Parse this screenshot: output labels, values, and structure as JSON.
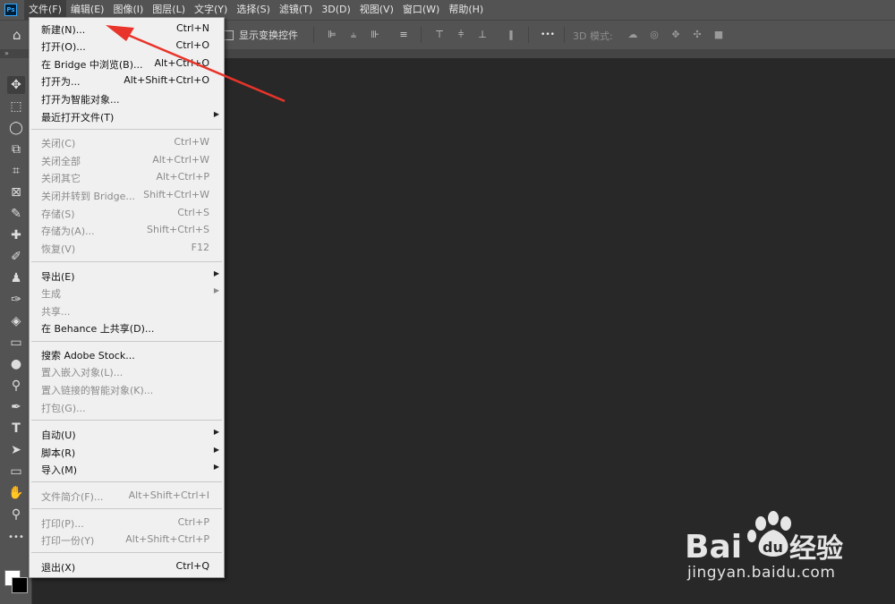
{
  "app": {
    "logo": "Ps"
  },
  "menubar": {
    "items": [
      {
        "label": "文件(F)"
      },
      {
        "label": "编辑(E)"
      },
      {
        "label": "图像(I)"
      },
      {
        "label": "图层(L)"
      },
      {
        "label": "文字(Y)"
      },
      {
        "label": "选择(S)"
      },
      {
        "label": "滤镜(T)"
      },
      {
        "label": "3D(D)"
      },
      {
        "label": "视图(V)"
      },
      {
        "label": "窗口(W)"
      },
      {
        "label": "帮助(H)"
      }
    ]
  },
  "options": {
    "show_transform_label": "显示变换控件",
    "more_label": "•••",
    "mode_3d_label": "3D 模式:"
  },
  "file_menu": {
    "items": [
      {
        "label": "新建(N)...",
        "shortcut": "Ctrl+N",
        "enabled": true
      },
      {
        "label": "打开(O)...",
        "shortcut": "Ctrl+O",
        "enabled": true
      },
      {
        "label": "在 Bridge 中浏览(B)...",
        "shortcut": "Alt+Ctrl+O",
        "enabled": true
      },
      {
        "label": "打开为...",
        "shortcut": "Alt+Shift+Ctrl+O",
        "enabled": true
      },
      {
        "label": "打开为智能对象...",
        "shortcut": "",
        "enabled": true
      },
      {
        "label": "最近打开文件(T)",
        "shortcut": "",
        "enabled": true,
        "submenu": true
      },
      {
        "label": "关闭(C)",
        "shortcut": "Ctrl+W",
        "enabled": false
      },
      {
        "label": "关闭全部",
        "shortcut": "Alt+Ctrl+W",
        "enabled": false
      },
      {
        "label": "关闭其它",
        "shortcut": "Alt+Ctrl+P",
        "enabled": false
      },
      {
        "label": "关闭并转到 Bridge...",
        "shortcut": "Shift+Ctrl+W",
        "enabled": false
      },
      {
        "label": "存储(S)",
        "shortcut": "Ctrl+S",
        "enabled": false
      },
      {
        "label": "存储为(A)...",
        "shortcut": "Shift+Ctrl+S",
        "enabled": false
      },
      {
        "label": "恢复(V)",
        "shortcut": "F12",
        "enabled": false
      },
      {
        "label": "导出(E)",
        "shortcut": "",
        "enabled": true,
        "submenu": true
      },
      {
        "label": "生成",
        "shortcut": "",
        "enabled": false,
        "submenu": true
      },
      {
        "label": "共享...",
        "shortcut": "",
        "enabled": false
      },
      {
        "label": "在 Behance 上共享(D)...",
        "shortcut": "",
        "enabled": true
      },
      {
        "label": "搜索 Adobe Stock...",
        "shortcut": "",
        "enabled": true
      },
      {
        "label": "置入嵌入对象(L)...",
        "shortcut": "",
        "enabled": false
      },
      {
        "label": "置入链接的智能对象(K)...",
        "shortcut": "",
        "enabled": false
      },
      {
        "label": "打包(G)...",
        "shortcut": "",
        "enabled": false
      },
      {
        "label": "自动(U)",
        "shortcut": "",
        "enabled": true,
        "submenu": true
      },
      {
        "label": "脚本(R)",
        "shortcut": "",
        "enabled": true,
        "submenu": true
      },
      {
        "label": "导入(M)",
        "shortcut": "",
        "enabled": true,
        "submenu": true
      },
      {
        "label": "文件简介(F)...",
        "shortcut": "Alt+Shift+Ctrl+I",
        "enabled": false
      },
      {
        "label": "打印(P)...",
        "shortcut": "Ctrl+P",
        "enabled": false
      },
      {
        "label": "打印一份(Y)",
        "shortcut": "Alt+Shift+Ctrl+P",
        "enabled": false
      },
      {
        "label": "退出(X)",
        "shortcut": "Ctrl+Q",
        "enabled": true
      }
    ]
  },
  "watermark": {
    "brand": "Bai du 经验",
    "url": "jingyan.baidu.com"
  },
  "colors": {
    "menubar": "#535353",
    "workspace": "#282828",
    "menu_bg": "#f0f0f0",
    "annotation_arrow": "#e8342a"
  },
  "icons": {
    "toolbar": [
      "move-icon",
      "marquee-icon",
      "lasso-icon",
      "object-select-icon",
      "crop-icon",
      "frame-icon",
      "eyedropper-icon",
      "healing-icon",
      "brush-icon",
      "stamp-icon",
      "history-brush-icon",
      "eraser-icon",
      "gradient-icon",
      "blur-icon",
      "dodge-icon",
      "pen-icon",
      "type-icon",
      "path-select-icon",
      "rectangle-icon",
      "hand-icon",
      "zoom-icon",
      "more-tools-icon"
    ]
  }
}
